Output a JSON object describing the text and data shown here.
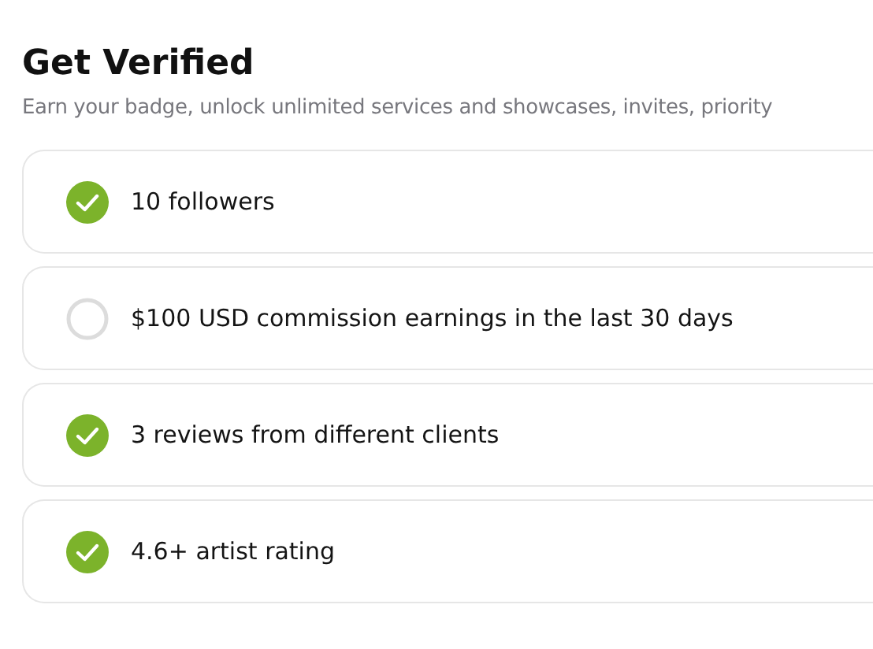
{
  "title": "Get Verified",
  "subtitle": "Earn your badge, unlock unlimited services and showcases, invites, priority",
  "requirements": [
    {
      "label": "10 followers",
      "checked": true
    },
    {
      "label": "$100 USD commission earnings in the last 30 days",
      "checked": false
    },
    {
      "label": "3 reviews from different clients",
      "checked": true
    },
    {
      "label": "4.6+ artist rating",
      "checked": true
    }
  ]
}
